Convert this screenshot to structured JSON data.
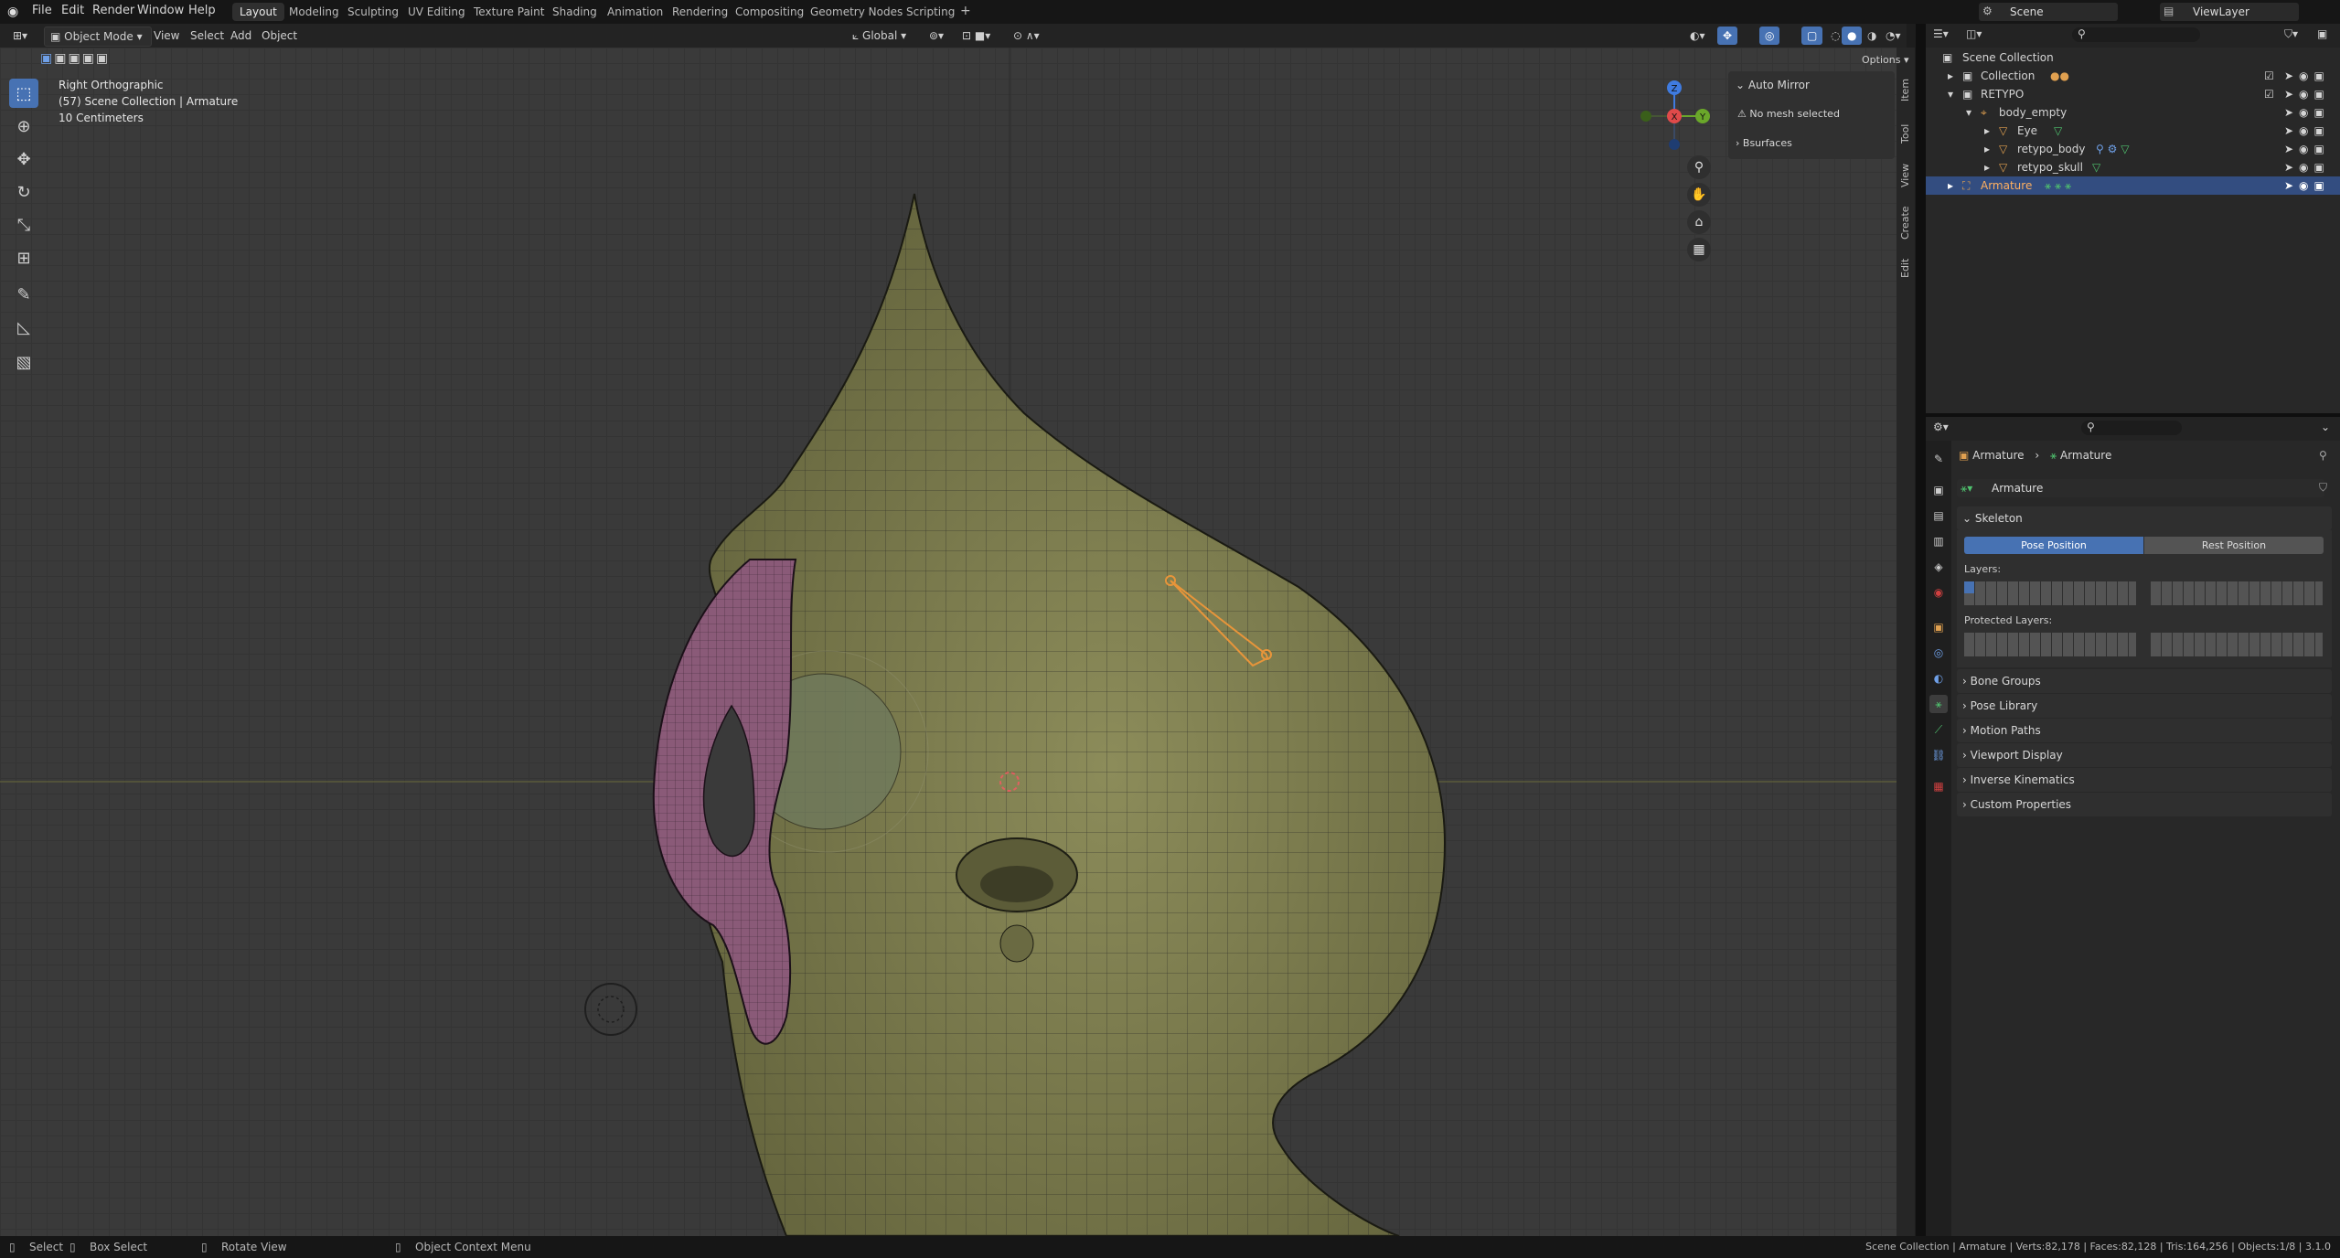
{
  "topbar": {
    "menus": [
      "File",
      "Edit",
      "Render",
      "Window",
      "Help"
    ],
    "workspaces": [
      "Layout",
      "Modeling",
      "Sculpting",
      "UV Editing",
      "Texture Paint",
      "Shading",
      "Animation",
      "Rendering",
      "Compositing",
      "Geometry Nodes",
      "Scripting"
    ],
    "active_workspace": "Layout",
    "scene": "Scene",
    "view_layer": "ViewLayer"
  },
  "viewport_header": {
    "mode": "Object Mode",
    "menus": [
      "View",
      "Select",
      "Add",
      "Object"
    ],
    "orientation": "Global",
    "options": "Options"
  },
  "overlay": {
    "view_name": "Right Orthographic",
    "collection": "(57) Scene Collection | Armature",
    "scale": "10 Centimeters"
  },
  "npanel": {
    "auto_mirror": "Auto Mirror",
    "no_mesh": "No mesh selected",
    "bsurfaces": "Bsurfaces",
    "tabs": [
      "Item",
      "Tool",
      "View",
      "Create",
      "Edit"
    ]
  },
  "gizmo": {
    "z": "Z",
    "x": "X",
    "y": "Y"
  },
  "outliner": {
    "rows": [
      {
        "label": "Scene Collection"
      },
      {
        "label": "Collection"
      },
      {
        "label": "RETYPO"
      },
      {
        "label": "body_empty"
      },
      {
        "label": "Eye"
      },
      {
        "label": "retypo_body"
      },
      {
        "label": "retypo_skull"
      },
      {
        "label": "Armature"
      }
    ]
  },
  "properties": {
    "breadcrumb_object": "Armature",
    "breadcrumb_data": "Armature",
    "datablock_name": "Armature",
    "skeleton": "Skeleton",
    "pose_position": "Pose Position",
    "rest_position": "Rest Position",
    "layers_label": "Layers:",
    "protected_layers_label": "Protected Layers:",
    "panels": [
      "Bone Groups",
      "Pose Library",
      "Motion Paths",
      "Viewport Display",
      "Inverse Kinematics",
      "Custom Properties"
    ]
  },
  "statusbar": {
    "select": "Select",
    "box_select": "Box Select",
    "rotate_view": "Rotate View",
    "context_menu": "Object Context Menu",
    "stats": "Scene Collection | Armature | Verts:82,178 | Faces:82,128 | Tris:164,256 | Objects:1/8 | 3.1.0"
  },
  "colors": {
    "accent": "#4772b3",
    "selected_row": "#334d80",
    "mesh_fill": "#7c7c4e",
    "ear_fill": "#8a5a78",
    "bone": "#e8953a"
  }
}
